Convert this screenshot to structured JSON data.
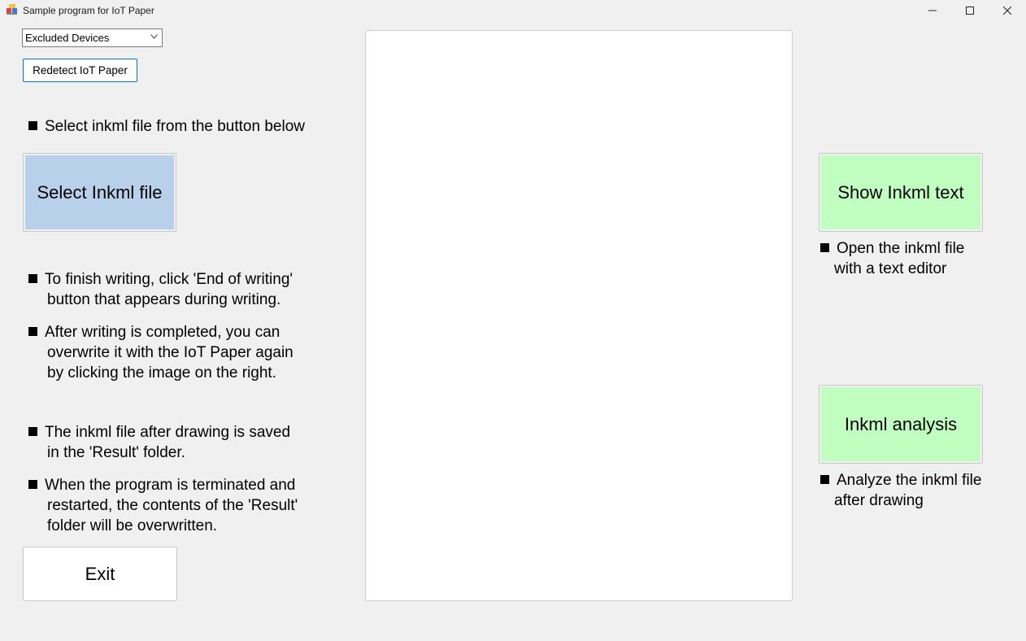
{
  "window": {
    "title": "Sample program for IoT Paper",
    "minimize_icon": "minimize-icon",
    "maximize_icon": "maximize-icon",
    "close_icon": "close-icon"
  },
  "device_select": {
    "value": "Excluded Devices"
  },
  "redetect_button": {
    "label": "Redetect IoT Paper"
  },
  "instructions": {
    "select_file": "Select inkml file from the button below",
    "finish_writing_line1": "To finish writing, click 'End of writing'",
    "finish_writing_line2": "button that appears during writing.",
    "overwrite_line1": "After writing is completed, you can",
    "overwrite_line2": "overwrite it with the IoT Paper again",
    "overwrite_line3": "by clicking the image on the right.",
    "saved_line1": "The inkml file after drawing is saved",
    "saved_line2": "in the 'Result' folder.",
    "restart_line1": "When the program is terminated and",
    "restart_line2": "restarted, the contents of the 'Result'",
    "restart_line3": "folder will be overwritten."
  },
  "buttons": {
    "select_inkml": "Select Inkml file",
    "exit": "Exit",
    "show_inkml_text": "Show Inkml text",
    "inkml_analysis": "Inkml analysis"
  },
  "right_notes": {
    "show_line1": "Open the inkml file",
    "show_line2": "with a text editor",
    "analysis_line1": "Analyze the inkml file",
    "analysis_line2": "after drawing"
  },
  "colors": {
    "select_button_bg": "#b8d0ea",
    "green_button_bg": "#c0ffc0",
    "accent_border": "#0078d4"
  }
}
